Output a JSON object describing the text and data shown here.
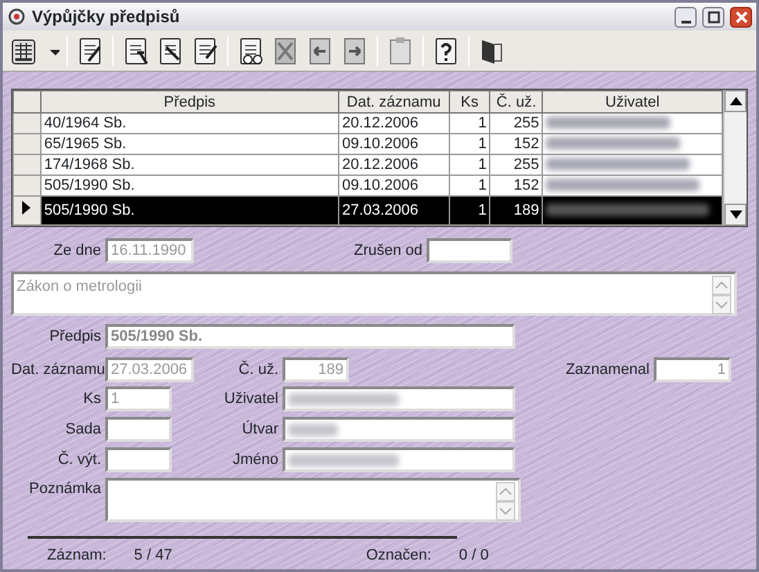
{
  "window": {
    "title": "Výpůjčky předpisů"
  },
  "table": {
    "columns": [
      "Předpis",
      "Dat. záznamu",
      "Ks",
      "Č. už.",
      "Uživatel"
    ],
    "rows": [
      {
        "cells": [
          "40/1964 Sb.",
          "20.12.2006",
          "1",
          "255"
        ],
        "selected": false
      },
      {
        "cells": [
          "65/1965 Sb.",
          "09.10.2006",
          "1",
          "152"
        ],
        "selected": false
      },
      {
        "cells": [
          "174/1968 Sb.",
          "20.12.2006",
          "1",
          "255"
        ],
        "selected": false
      },
      {
        "cells": [
          "505/1990 Sb.",
          "09.10.2006",
          "1",
          "152"
        ],
        "selected": false
      },
      {
        "cells": [
          "505/1990 Sb.",
          "27.03.2006",
          "1",
          "189"
        ],
        "selected": true
      }
    ]
  },
  "form": {
    "ze_dne": {
      "label": "Ze dne",
      "value": "16.11.1990"
    },
    "zrusen_od": {
      "label": "Zrušen od"
    },
    "nazev": {
      "value": "Zákon o metrologii"
    },
    "predpis": {
      "label": "Předpis",
      "value": "505/1990 Sb."
    },
    "dat_zaznamu": {
      "label": "Dat. záznamu",
      "value": "27.03.2006"
    },
    "c_uz": {
      "label": "Č. už.",
      "value": "189"
    },
    "zaznamenal": {
      "label": "Zaznamenal",
      "value": "1"
    },
    "ks": {
      "label": "Ks",
      "value": "1"
    },
    "uzivatel": {
      "label": "Uživatel"
    },
    "sada": {
      "label": "Sada"
    },
    "utvar": {
      "label": "Útvar"
    },
    "c_vyt": {
      "label": "Č. výt."
    },
    "jmeno": {
      "label": "Jméno"
    },
    "poznamka": {
      "label": "Poznámka"
    }
  },
  "status_bar": {
    "record_label": "Záznam:",
    "record": "5 / 47",
    "marked_label": "Označen:",
    "marked": "0 / 0"
  }
}
